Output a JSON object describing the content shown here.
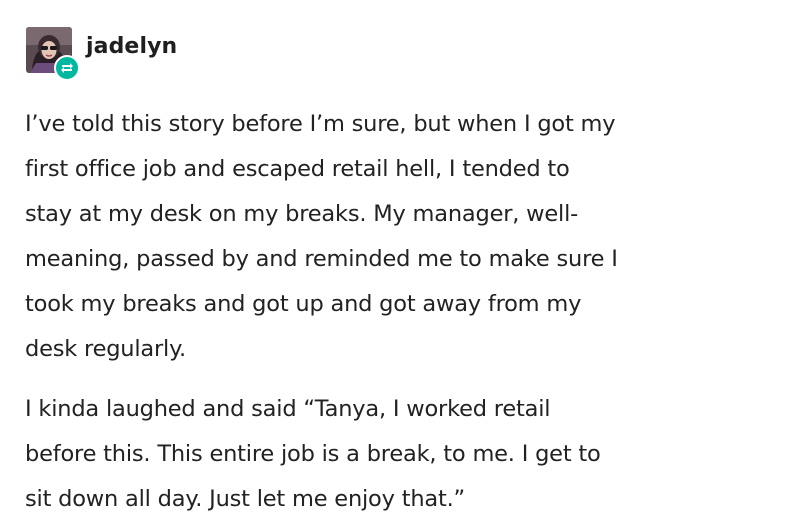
{
  "post": {
    "username": "jadelyn",
    "avatar_icon": "user-avatar",
    "badge_icon": "reblog-icon",
    "badge_color": "#00b8a0",
    "paragraphs": [
      {
        "lines": [
          "I’ve told this story before I’m sure, but when I got my",
          "first office job and escaped retail hell, I tended to",
          "stay at my desk on my breaks. My manager, well-",
          "meaning, passed by and reminded me to make sure I",
          "took my breaks and got up and got away from my",
          "desk regularly."
        ]
      },
      {
        "lines": [
          "I kinda laughed and said “Tanya, I worked retail",
          "before this. This entire job is a break, to me. I get to",
          "sit down all day. Just let me enjoy that.”"
        ]
      }
    ]
  }
}
